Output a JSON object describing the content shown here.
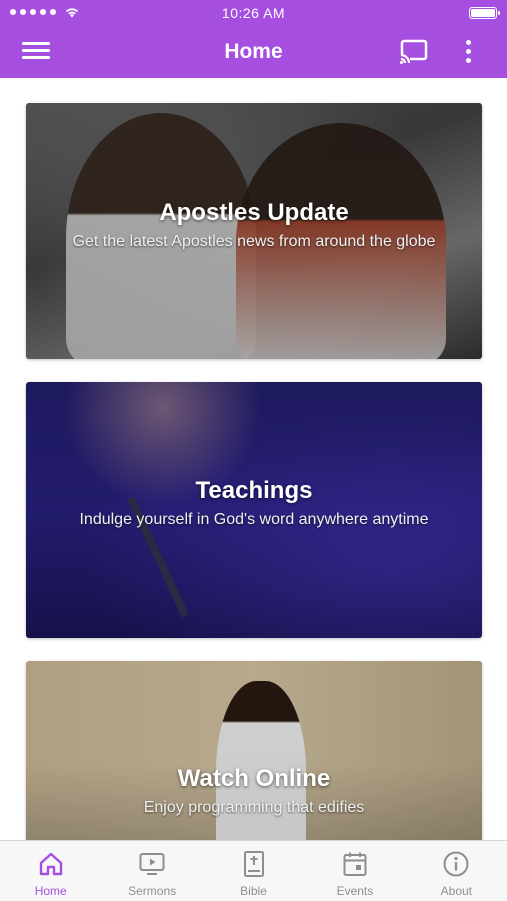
{
  "status_bar": {
    "time": "10:26 AM"
  },
  "app_bar": {
    "title": "Home"
  },
  "cards": [
    {
      "title": "Apostles Update",
      "subtitle": "Get the latest Apostles news from around the globe"
    },
    {
      "title": "Teachings",
      "subtitle": "Indulge yourself in God's word anywhere anytime"
    },
    {
      "title": "Watch Online",
      "subtitle": "Enjoy programming that edifies"
    }
  ],
  "tab_bar": {
    "active_tab": "Home",
    "tabs": [
      {
        "label": "Home",
        "icon": "home-icon"
      },
      {
        "label": "Sermons",
        "icon": "tv-icon"
      },
      {
        "label": "Bible",
        "icon": "bible-icon"
      },
      {
        "label": "Events",
        "icon": "calendar-icon"
      },
      {
        "label": "About",
        "icon": "info-icon"
      }
    ]
  },
  "colors": {
    "brand": "#a64ee0",
    "tab_inactive": "#8e8e8e",
    "tab_bar_bg": "#f7f7f7"
  }
}
